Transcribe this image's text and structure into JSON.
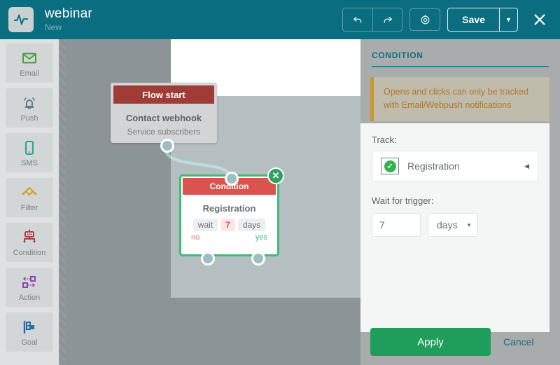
{
  "header": {
    "logo_icon": "pulse-waveform-icon",
    "title": "webinar",
    "subtitle": "New",
    "undo_icon": "undo-arrow-icon",
    "redo_icon": "redo-arrow-icon",
    "settings_icon": "target-gear-icon",
    "save_label": "Save",
    "save_caret_icon": "chevron-down-icon",
    "close_icon": "close-x-icon",
    "bg_color": "#0b6e80"
  },
  "sidebar": {
    "items": [
      {
        "label": "Email",
        "icon": "envelope-icon",
        "color": "#4a9b42"
      },
      {
        "label": "Push",
        "icon": "bell-icon",
        "color": "#5e7a8c"
      },
      {
        "label": "SMS",
        "icon": "mobile-phone-icon",
        "color": "#2aa192"
      },
      {
        "label": "Filter",
        "icon": "filter-diamond-icon",
        "color": "#d19b2a"
      },
      {
        "label": "Condition",
        "icon": "condition-node-icon",
        "color": "#9e4a44"
      },
      {
        "label": "Action",
        "icon": "action-squares-icon",
        "color": "#8e44ad"
      },
      {
        "label": "Goal",
        "icon": "flag-goal-icon",
        "color": "#2b6ca3"
      }
    ]
  },
  "canvas": {
    "start_node": {
      "header_label": "Flow start",
      "title": "Contact webhook",
      "subtitle": "Service subscribers",
      "header_color": "#9e3c35"
    },
    "condition_node": {
      "header_label": "Condition",
      "title": "Registration",
      "pill_wait": "wait",
      "pill_value": "7",
      "pill_unit": "days",
      "branch_no": "no",
      "branch_yes": "yes",
      "delete_icon": "close-x-icon",
      "header_color": "#d9534f",
      "selection_color": "#3dbd72"
    }
  },
  "panel": {
    "title": "CONDITION",
    "warning": "Opens and clicks can only be tracked with Email/Webpush notifications",
    "track_label": "Track:",
    "track_value": "Registration",
    "track_icon": "green-check-badge-icon",
    "track_caret_icon": "caret-left-icon",
    "wait_label": "Wait for trigger:",
    "wait_value": "7",
    "wait_unit": "days",
    "unit_caret_icon": "caret-down-icon",
    "apply_label": "Apply",
    "cancel_label": "Cancel",
    "accent_color": "#1a6b7d",
    "apply_color": "#1e9e5a",
    "warning_border_color": "#cc9a28"
  }
}
